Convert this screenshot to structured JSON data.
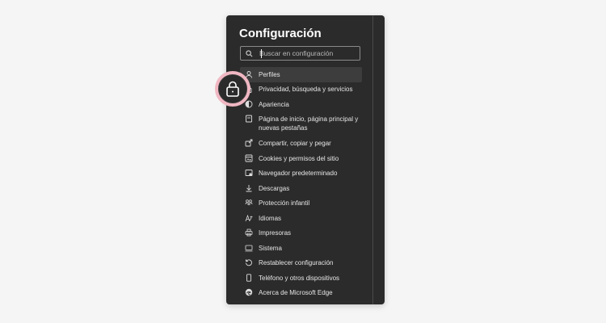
{
  "settings": {
    "title": "Configuración",
    "search_placeholder": "Buscar en configuración",
    "items": [
      {
        "label": "Perfiles",
        "icon": "profile-icon",
        "active": true
      },
      {
        "label": "Privacidad, búsqueda y servicios",
        "icon": "lock-icon"
      },
      {
        "label": "Apariencia",
        "icon": "appearance-icon"
      },
      {
        "label": "Página de inicio, página principal y nuevas pestañas",
        "icon": "home-icon"
      },
      {
        "label": "Compartir, copiar y pegar",
        "icon": "share-icon"
      },
      {
        "label": "Cookies y permisos del sitio",
        "icon": "cookies-icon"
      },
      {
        "label": "Navegador predeterminado",
        "icon": "default-browser-icon"
      },
      {
        "label": "Descargas",
        "icon": "download-icon"
      },
      {
        "label": "Protección infantil",
        "icon": "family-icon"
      },
      {
        "label": "Idiomas",
        "icon": "languages-icon"
      },
      {
        "label": "Impresoras",
        "icon": "printer-icon"
      },
      {
        "label": "Sistema",
        "icon": "system-icon"
      },
      {
        "label": "Restablecer configuración",
        "icon": "reset-icon"
      },
      {
        "label": "Teléfono y otros dispositivos",
        "icon": "phone-icon"
      },
      {
        "label": "Acerca de Microsoft Edge",
        "icon": "edge-icon"
      }
    ]
  },
  "highlight": {
    "icon": "lock-icon",
    "accent_color": "#f0b7c2"
  },
  "colors": {
    "panel_bg": "#2b2b2b",
    "page_bg": "#f5f5f5",
    "text": "#e6e6e6"
  }
}
